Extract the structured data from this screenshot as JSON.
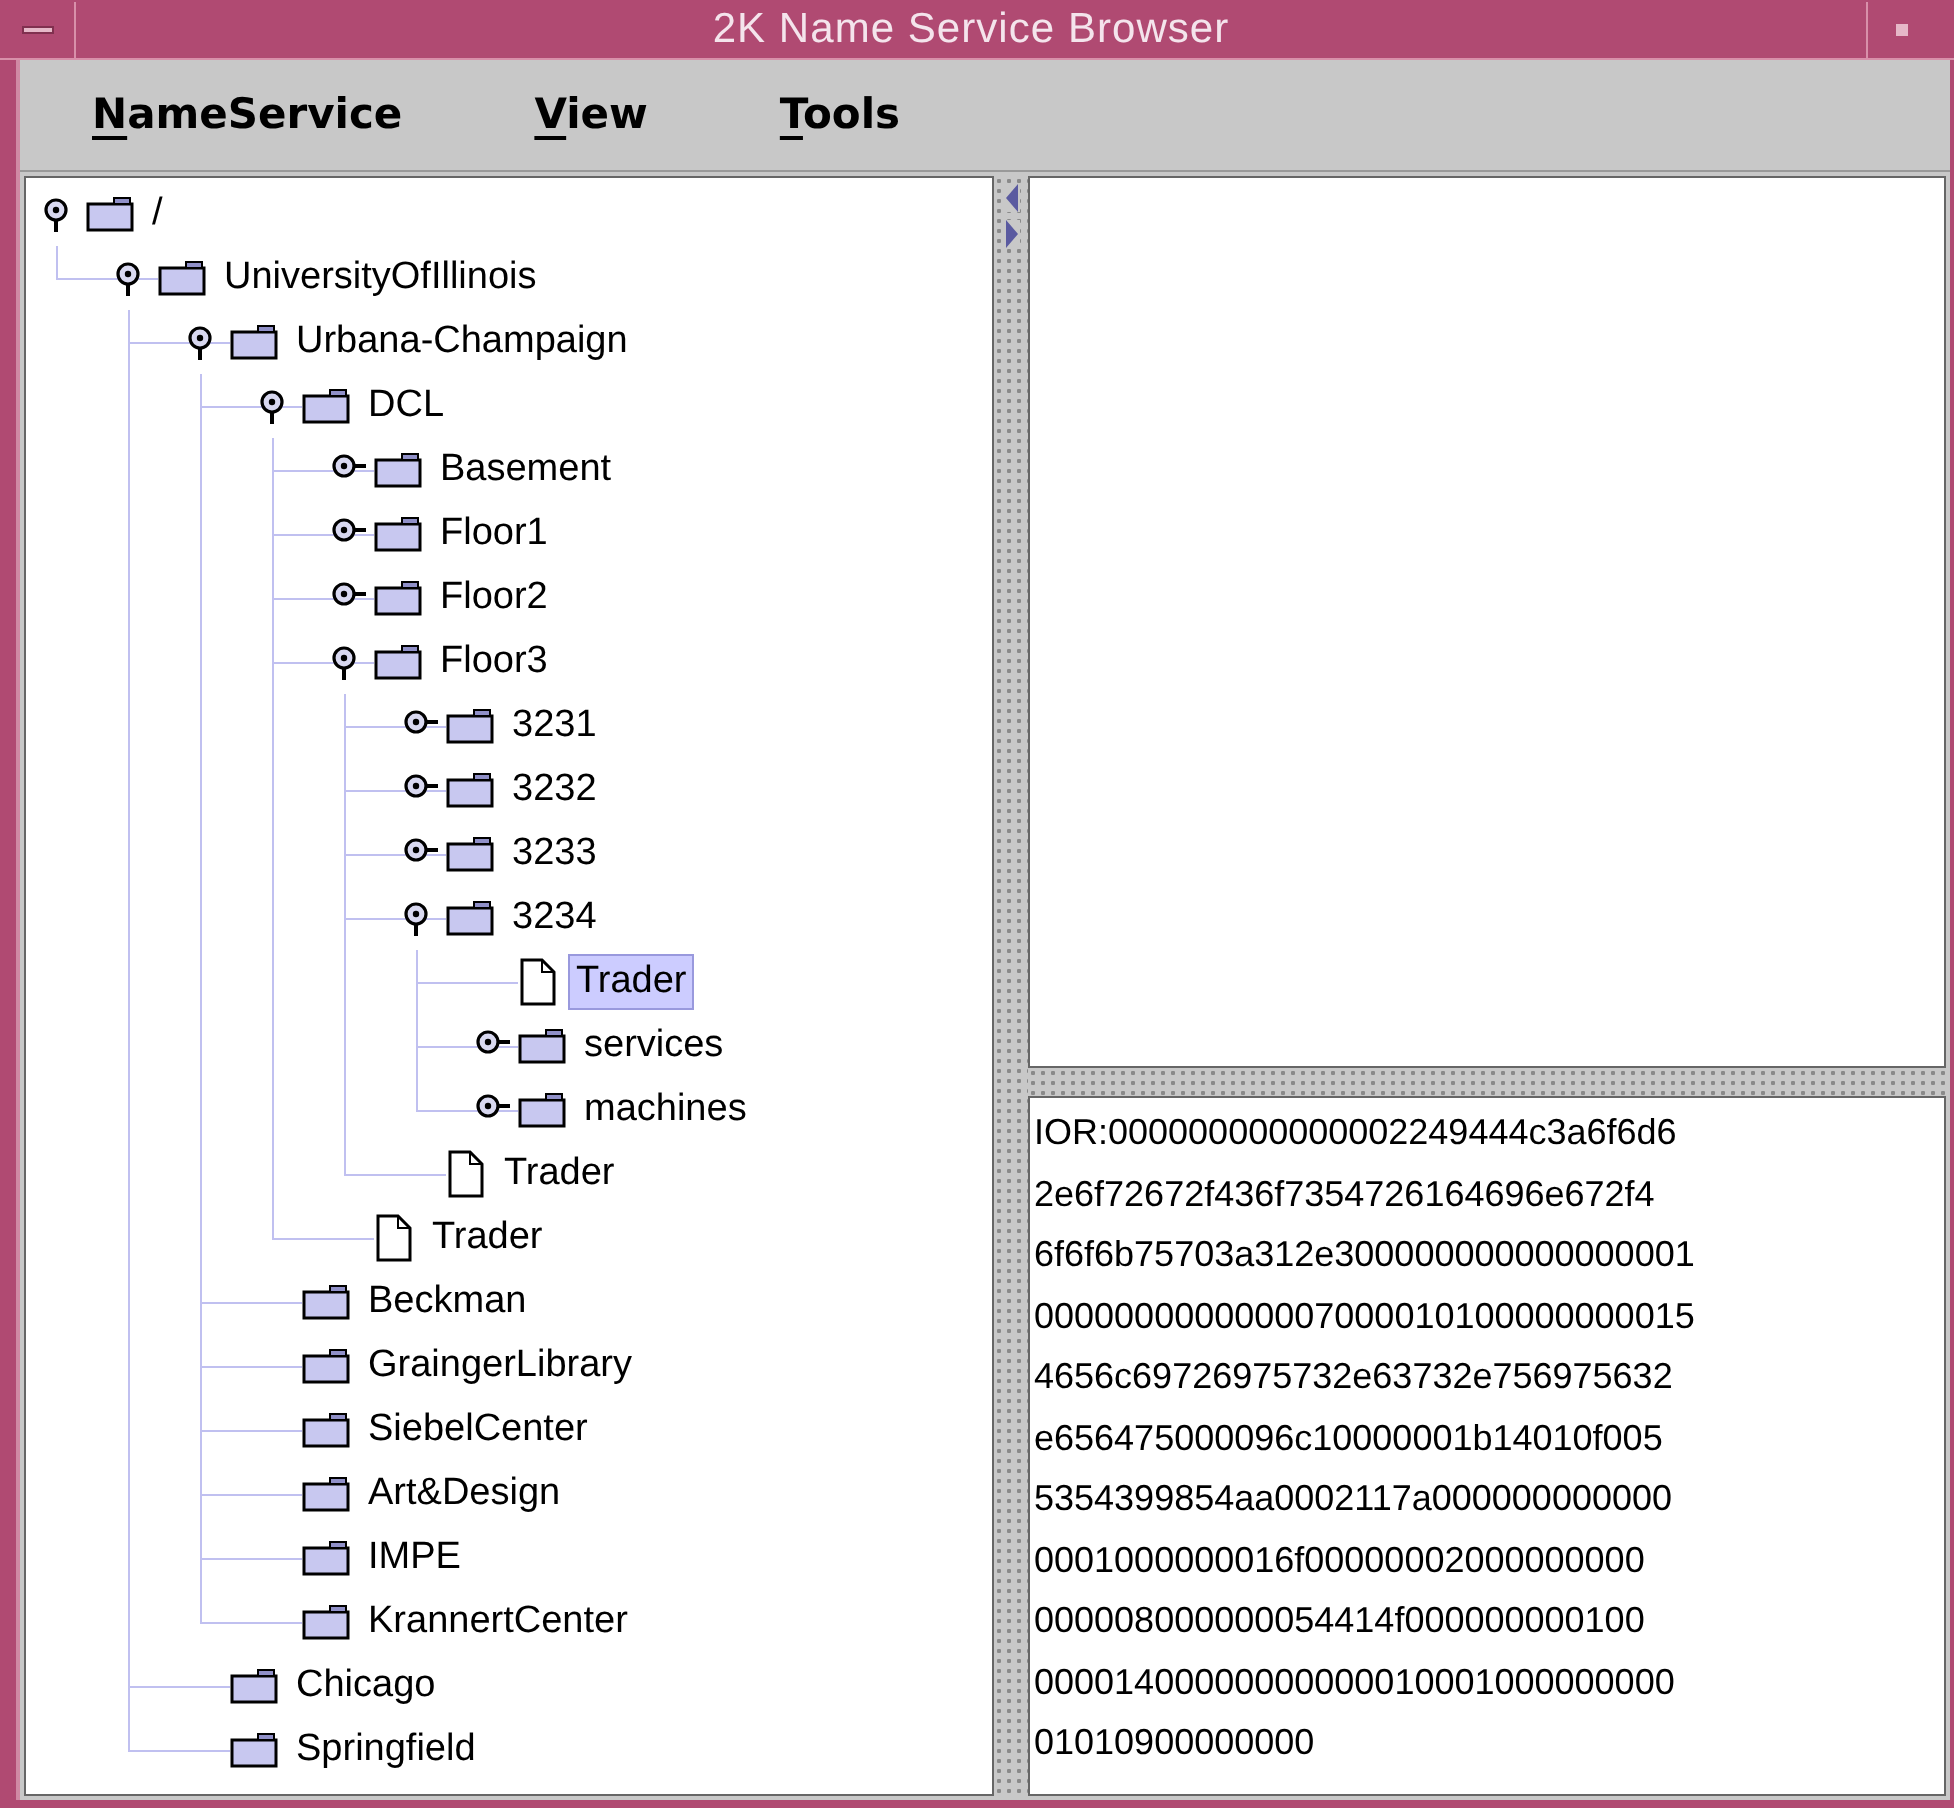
{
  "window": {
    "title": "2K Name Service Browser"
  },
  "menu": [
    "NameService",
    "View",
    "Tools"
  ],
  "tree": [
    {
      "label": "/",
      "kind": "folder",
      "expanded": true,
      "selected": false,
      "children": [
        {
          "label": "UniversityOfIllinois",
          "kind": "folder",
          "expanded": true,
          "selected": false,
          "children": [
            {
              "label": "Urbana-Champaign",
              "kind": "folder",
              "expanded": true,
              "selected": false,
              "children": [
                {
                  "label": "DCL",
                  "kind": "folder",
                  "expanded": true,
                  "selected": false,
                  "children": [
                    {
                      "label": "Basement",
                      "kind": "folder",
                      "expanded": false,
                      "selected": false
                    },
                    {
                      "label": "Floor1",
                      "kind": "folder",
                      "expanded": false,
                      "selected": false
                    },
                    {
                      "label": "Floor2",
                      "kind": "folder",
                      "expanded": false,
                      "selected": false
                    },
                    {
                      "label": "Floor3",
                      "kind": "folder",
                      "expanded": true,
                      "selected": false,
                      "children": [
                        {
                          "label": "3231",
                          "kind": "folder",
                          "expanded": false,
                          "selected": false
                        },
                        {
                          "label": "3232",
                          "kind": "folder",
                          "expanded": false,
                          "selected": false
                        },
                        {
                          "label": "3233",
                          "kind": "folder",
                          "expanded": false,
                          "selected": false
                        },
                        {
                          "label": "3234",
                          "kind": "folder",
                          "expanded": true,
                          "selected": false,
                          "children": [
                            {
                              "label": "Trader",
                              "kind": "document",
                              "selected": true
                            },
                            {
                              "label": "services",
                              "kind": "folder",
                              "expanded": false,
                              "selected": false
                            },
                            {
                              "label": "machines",
                              "kind": "folder",
                              "expanded": false,
                              "selected": false
                            }
                          ]
                        },
                        {
                          "label": "Trader",
                          "kind": "document",
                          "selected": false
                        }
                      ]
                    },
                    {
                      "label": "Trader",
                      "kind": "document",
                      "selected": false
                    }
                  ]
                },
                {
                  "label": "Beckman",
                  "kind": "empty_folder",
                  "selected": false
                },
                {
                  "label": "GraingerLibrary",
                  "kind": "empty_folder",
                  "selected": false
                },
                {
                  "label": "SiebelCenter",
                  "kind": "empty_folder",
                  "selected": false
                },
                {
                  "label": "Art&Design",
                  "kind": "empty_folder",
                  "selected": false
                },
                {
                  "label": "IMPE",
                  "kind": "empty_folder",
                  "selected": false
                },
                {
                  "label": "KrannertCenter",
                  "kind": "empty_folder",
                  "selected": false
                }
              ]
            },
            {
              "label": "Chicago",
              "kind": "empty_folder",
              "selected": false
            },
            {
              "label": "Springfield",
              "kind": "empty_folder",
              "selected": false
            }
          ]
        }
      ]
    }
  ],
  "ior_lines": [
    "IOR:000000000000002249444c3a6f6d6",
    "2e6f72672f436f7354726164696e672f4",
    "6f6f6b75703a312e300000000000000001",
    "000000000000007000010100000000015",
    "4656c69726975732e63732e756975632",
    "e656475000096c10000001b14010f005",
    "5354399854aa0002117a000000000000",
    "0001000000016f00000002000000000",
    "000008000000054414f000000000100",
    "00001400000000000010001000000000",
    "01010900000000"
  ]
}
